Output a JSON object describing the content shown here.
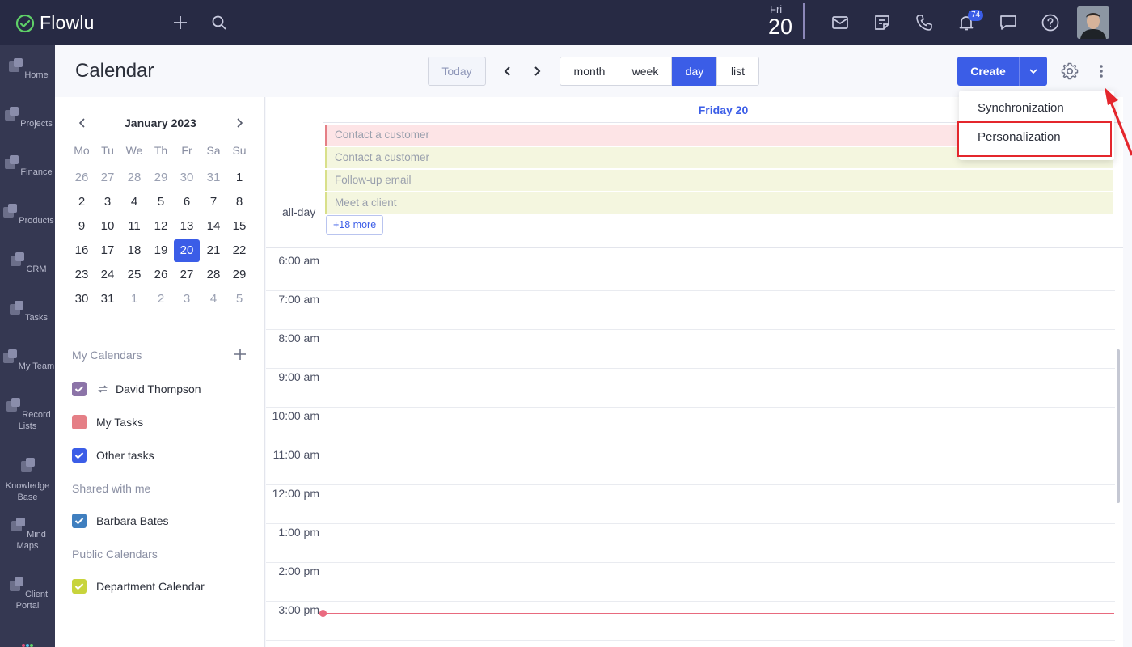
{
  "app": {
    "name": "Flowlu"
  },
  "topbar": {
    "date_dow": "Fri",
    "date_num": "20",
    "notification_count": "74"
  },
  "nav": [
    {
      "label": "Home",
      "icon": "home-icon"
    },
    {
      "label": "Projects",
      "icon": "projects-icon"
    },
    {
      "label": "Finance",
      "icon": "finance-icon"
    },
    {
      "label": "Products",
      "icon": "products-icon"
    },
    {
      "label": "CRM",
      "icon": "crm-icon"
    },
    {
      "label": "Tasks",
      "icon": "tasks-icon"
    },
    {
      "label": "My Team",
      "icon": "team-icon"
    },
    {
      "label": "Record Lists",
      "icon": "record-lists-icon"
    },
    {
      "label": "Knowledge Base",
      "icon": "knowledge-base-icon"
    },
    {
      "label": "Mind Maps",
      "icon": "mind-maps-icon"
    },
    {
      "label": "Client Portal",
      "icon": "client-portal-icon"
    }
  ],
  "header": {
    "title": "Calendar",
    "today": "Today",
    "views": [
      "month",
      "week",
      "day",
      "list"
    ],
    "active_view": "day",
    "create": "Create"
  },
  "mini_calendar": {
    "month_label": "January 2023",
    "weekdays": [
      "Mo",
      "Tu",
      "We",
      "Th",
      "Fr",
      "Sa",
      "Su"
    ],
    "weeks": [
      [
        "26",
        "27",
        "28",
        "29",
        "30",
        "31",
        "1"
      ],
      [
        "2",
        "3",
        "4",
        "5",
        "6",
        "7",
        "8"
      ],
      [
        "9",
        "10",
        "11",
        "12",
        "13",
        "14",
        "15"
      ],
      [
        "16",
        "17",
        "18",
        "19",
        "20",
        "21",
        "22"
      ],
      [
        "23",
        "24",
        "25",
        "26",
        "27",
        "28",
        "29"
      ],
      [
        "30",
        "31",
        "1",
        "2",
        "3",
        "4",
        "5"
      ]
    ],
    "selected": "20"
  },
  "calendars": {
    "my_heading": "My Calendars",
    "my": [
      {
        "name": "David Thompson",
        "color": "#8c74a8",
        "checked": true,
        "sync": true
      },
      {
        "name": "My Tasks",
        "color": "#e57f86",
        "checked": false,
        "sync": false
      },
      {
        "name": "Other tasks",
        "color": "#3b5de7",
        "checked": true,
        "sync": false
      }
    ],
    "shared_heading": "Shared with me",
    "shared": [
      {
        "name": "Barbara Bates",
        "color": "#3f7fbf",
        "checked": true
      }
    ],
    "public_heading": "Public Calendars",
    "public": [
      {
        "name": "Department Calendar",
        "color": "#c8d43c",
        "checked": true
      }
    ]
  },
  "day_view": {
    "header": "Friday 20",
    "all_day_label": "all-day",
    "events": [
      {
        "title": "Contact a customer",
        "color": "#e57f86",
        "bg": "#fde4e6"
      },
      {
        "title": "Contact a customer",
        "color": "#d9e08a",
        "bg": "#f4f6df"
      },
      {
        "title": "Follow-up email",
        "color": "#d9e08a",
        "bg": "#f4f6df"
      },
      {
        "title": "Meet a client",
        "color": "#d9e08a",
        "bg": "#f4f6df"
      }
    ],
    "more": "+18 more",
    "times": [
      "6:00 am",
      "7:00 am",
      "8:00 am",
      "9:00 am",
      "10:00 am",
      "11:00 am",
      "12:00 pm",
      "1:00 pm",
      "2:00 pm",
      "3:00 pm"
    ]
  },
  "dropdown": {
    "items": [
      "Synchronization",
      "Personalization"
    ],
    "highlighted": "Personalization"
  },
  "colors": {
    "accent": "#3b5de7",
    "topbar": "#272a44",
    "nav": "#353852",
    "annotation": "#e4262c"
  }
}
